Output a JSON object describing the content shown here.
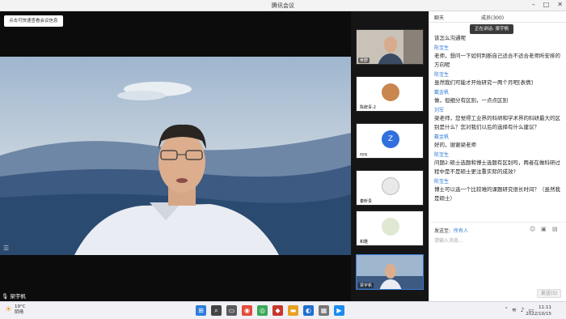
{
  "window": {
    "title": "腾讯会议"
  },
  "main": {
    "tip": "点击可快速查看会议信息",
    "speaker_name": "梁宇帆"
  },
  "thumbs": [
    {
      "name": "吴野"
    },
    {
      "name": "陈辞青-2"
    },
    {
      "name": "zyq",
      "initial": "Z"
    },
    {
      "name": "秦昕贵"
    },
    {
      "name": "和雅"
    },
    {
      "name": "梁宇帆"
    }
  ],
  "chat": {
    "tab_chat": "聊天",
    "tab_members": "成员(300)",
    "speaking_banner": "正在讲话: 梁宇帆",
    "messages": [
      {
        "sender": "",
        "text": "该怎么沟通呢"
      },
      {
        "sender": "陈宝生",
        "text": "老师，想问一下如何判断自己适合不适合老师所安排的方向呢"
      },
      {
        "sender": "陈宝生",
        "text": "虽然我们可能才开始研究一两个月吧[表情]"
      },
      {
        "sender": "戴金帆",
        "text": "做，但细分有区别，一点点区别"
      },
      {
        "sender": "刘军",
        "text": "梁老师，您觉得工业界的科研和学术界的科研最大的区别是什么？您对我们以后的选择有什么建议？"
      },
      {
        "sender": "戴金帆",
        "text": "好的，谢谢梁老师"
      },
      {
        "sender": "陈宝生",
        "text": "问题2:硕士选题和博士选题有区别吗，两者在做科研过程中是不是硕士更注重实际的成效?"
      },
      {
        "sender": "陈宝生",
        "text": "博士可以选一个比较难的课题研究很长时间？（虽然我是硕士）"
      }
    ],
    "send_to_label": "发送至:",
    "send_to_value": "所有人",
    "input_placeholder": "请输入消息...",
    "send_button": "发送(S)"
  },
  "taskbar": {
    "temperature": "19°C",
    "weather": "阴晴",
    "time": "11:11",
    "date": "2022/10/15"
  },
  "colors": {
    "accent": "#2e7bd6"
  }
}
